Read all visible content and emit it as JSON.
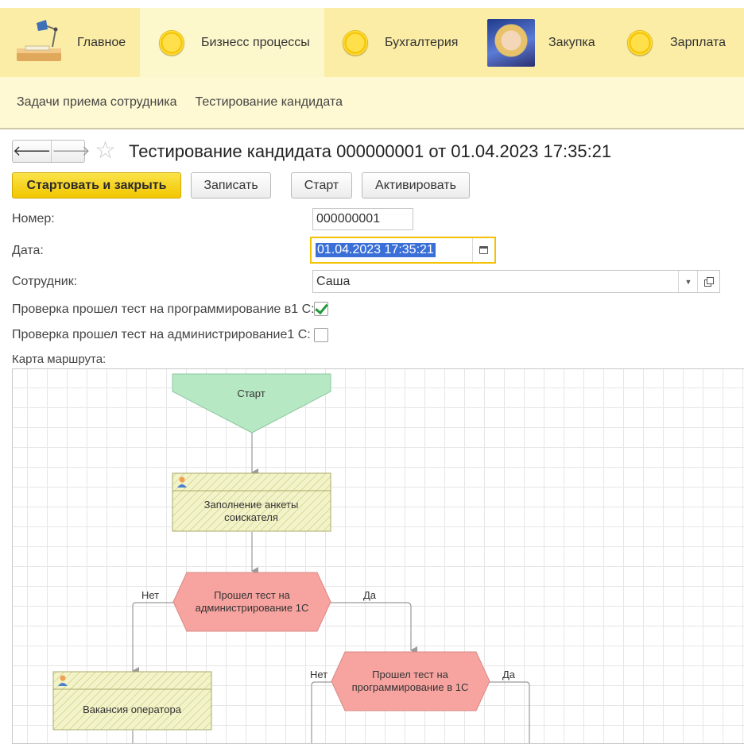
{
  "sections": [
    {
      "label": "Главное",
      "icon": "desk-lamp-icon",
      "active": false
    },
    {
      "label": "Бизнесс процессы",
      "icon": "coin-icon",
      "active": true
    },
    {
      "label": "Бухгалтерия",
      "icon": "coin-icon",
      "active": false
    },
    {
      "label": "Закупка",
      "icon": "avatar-image",
      "active": false
    },
    {
      "label": "Зарплата",
      "icon": "coin-icon",
      "active": false
    }
  ],
  "subnav": [
    "Задачи приема сотрудника",
    "Тестирование кандидата"
  ],
  "form": {
    "title": "Тестирование кандидата 000000001 от 01.04.2023 17:35:21",
    "back_icon": "arrow-left-icon",
    "forward_icon": "arrow-right-icon",
    "favorite_icon": "star-icon"
  },
  "commands": {
    "start_close": "Стартовать и закрыть",
    "save": "Записать",
    "start": "Старт",
    "activate": "Активировать"
  },
  "fields": {
    "number_label": "Номер:",
    "number_value": "000000001",
    "date_label": "Дата:",
    "date_value": "01.04.2023 17:35:21",
    "employee_label": "Сотрудник:",
    "employee_value": "Саша",
    "check_prog_label": "Проверка прошел тест на программирование в1 С:",
    "check_prog_value": true,
    "check_admin_label": "Проверка прошел тест на администрирование1 С:",
    "check_admin_value": false,
    "route_map_label": "Карта маршрута:"
  },
  "route_map": {
    "start": "Старт",
    "task1_line1": "Заполнение анкеты",
    "task1_line2": "соискателя",
    "cond1_line1": "Прошел тест на",
    "cond1_line2": "администрирование 1С",
    "cond1_no": "Нет",
    "cond1_yes": "Да",
    "task2": "Вакансия оператора",
    "cond2_line1": "Прошел тест на",
    "cond2_line2": "программирование в 1С",
    "cond2_no": "Нет",
    "cond2_yes": "Да"
  },
  "colors": {
    "section_bar": "#fbeda5",
    "start_point": "#b7e8c4",
    "condition": "#f7a4a0",
    "task_hatch": "#f0f0c0",
    "primary_button": "#f2c600"
  }
}
